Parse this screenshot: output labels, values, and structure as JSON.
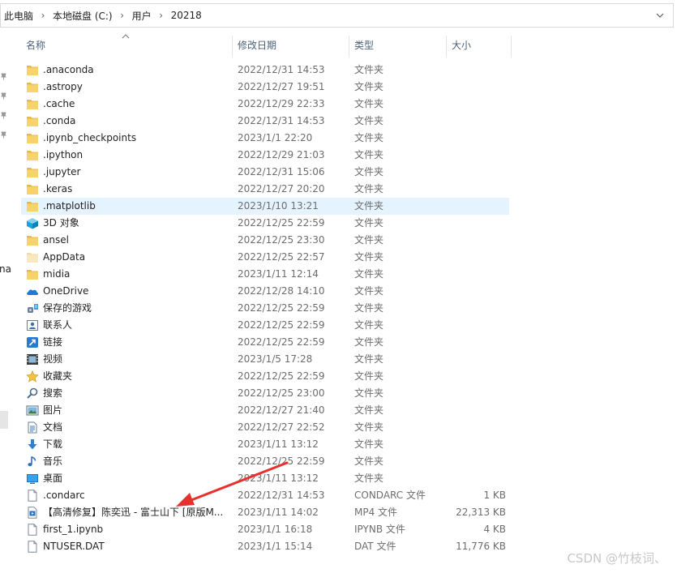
{
  "address": {
    "crumbs": [
      "此电脑",
      "本地磁盘 (C:)",
      "用户",
      "20218"
    ],
    "separator": "›",
    "dropdown_icon": "chevron-down-icon"
  },
  "nav": {
    "fragment": "na"
  },
  "columns": {
    "name": "名称",
    "modified": "修改日期",
    "type": "类型",
    "size": "大小"
  },
  "files": [
    {
      "name": ".anaconda",
      "date": "2022/12/31 14:53",
      "type": "文件夹",
      "size": "",
      "icon": "folder-icon"
    },
    {
      "name": ".astropy",
      "date": "2022/12/27 19:51",
      "type": "文件夹",
      "size": "",
      "icon": "folder-icon"
    },
    {
      "name": ".cache",
      "date": "2022/12/29 22:33",
      "type": "文件夹",
      "size": "",
      "icon": "folder-icon"
    },
    {
      "name": ".conda",
      "date": "2022/12/31 14:53",
      "type": "文件夹",
      "size": "",
      "icon": "folder-icon"
    },
    {
      "name": ".ipynb_checkpoints",
      "date": "2023/1/1 22:20",
      "type": "文件夹",
      "size": "",
      "icon": "folder-icon"
    },
    {
      "name": ".ipython",
      "date": "2022/12/29 21:03",
      "type": "文件夹",
      "size": "",
      "icon": "folder-icon"
    },
    {
      "name": ".jupyter",
      "date": "2022/12/31 15:06",
      "type": "文件夹",
      "size": "",
      "icon": "folder-icon"
    },
    {
      "name": ".keras",
      "date": "2022/12/27 20:20",
      "type": "文件夹",
      "size": "",
      "icon": "folder-icon"
    },
    {
      "name": ".matplotlib",
      "date": "2023/1/10 13:21",
      "type": "文件夹",
      "size": "",
      "icon": "folder-icon",
      "selected": true
    },
    {
      "name": "3D 对象",
      "date": "2022/12/25 22:59",
      "type": "文件夹",
      "size": "",
      "icon": "3d-objects-icon"
    },
    {
      "name": "ansel",
      "date": "2022/12/25 23:30",
      "type": "文件夹",
      "size": "",
      "icon": "folder-icon"
    },
    {
      "name": "AppData",
      "date": "2022/12/25 22:57",
      "type": "文件夹",
      "size": "",
      "icon": "folder-hidden-icon"
    },
    {
      "name": "midia",
      "date": "2023/1/11 12:14",
      "type": "文件夹",
      "size": "",
      "icon": "folder-icon"
    },
    {
      "name": "OneDrive",
      "date": "2022/12/28 14:10",
      "type": "文件夹",
      "size": "",
      "icon": "onedrive-icon"
    },
    {
      "name": "保存的游戏",
      "date": "2022/12/25 22:59",
      "type": "文件夹",
      "size": "",
      "icon": "saved-games-icon"
    },
    {
      "name": "联系人",
      "date": "2022/12/25 22:59",
      "type": "文件夹",
      "size": "",
      "icon": "contacts-icon"
    },
    {
      "name": "链接",
      "date": "2022/12/25 22:59",
      "type": "文件夹",
      "size": "",
      "icon": "links-icon"
    },
    {
      "name": "视频",
      "date": "2023/1/5 17:28",
      "type": "文件夹",
      "size": "",
      "icon": "videos-icon"
    },
    {
      "name": "收藏夹",
      "date": "2022/12/25 22:59",
      "type": "文件夹",
      "size": "",
      "icon": "favorites-icon"
    },
    {
      "name": "搜索",
      "date": "2022/12/25 23:00",
      "type": "文件夹",
      "size": "",
      "icon": "search-icon"
    },
    {
      "name": "图片",
      "date": "2022/12/27 21:40",
      "type": "文件夹",
      "size": "",
      "icon": "pictures-icon"
    },
    {
      "name": "文档",
      "date": "2022/12/27 22:52",
      "type": "文件夹",
      "size": "",
      "icon": "documents-icon"
    },
    {
      "name": "下载",
      "date": "2023/1/11 13:12",
      "type": "文件夹",
      "size": "",
      "icon": "downloads-icon"
    },
    {
      "name": "音乐",
      "date": "2022/12/25 22:59",
      "type": "文件夹",
      "size": "",
      "icon": "music-icon"
    },
    {
      "name": "桌面",
      "date": "2023/1/11 13:12",
      "type": "文件夹",
      "size": "",
      "icon": "desktop-icon"
    },
    {
      "name": ".condarc",
      "date": "2022/12/31 14:53",
      "type": "CONDARC 文件",
      "size": "1 KB",
      "icon": "file-icon"
    },
    {
      "name": "【高清修复】陈奕迅 - 富士山下 [原版M...",
      "date": "2023/1/11 14:02",
      "type": "MP4 文件",
      "size": "22,313 KB",
      "icon": "video-file-icon"
    },
    {
      "name": "first_1.ipynb",
      "date": "2023/1/1 16:18",
      "type": "IPYNB 文件",
      "size": "4 KB",
      "icon": "file-icon"
    },
    {
      "name": "NTUSER.DAT",
      "date": "2023/1/1 15:14",
      "type": "DAT 文件",
      "size": "11,776 KB",
      "icon": "file-icon"
    }
  ],
  "colors": {
    "accent_red": "#e8312f",
    "folder_yellow": "#f6d36b",
    "selected_row": "#e5f3ff",
    "header_text": "#4c607a"
  },
  "watermark": "CSDN @竹枝词、"
}
